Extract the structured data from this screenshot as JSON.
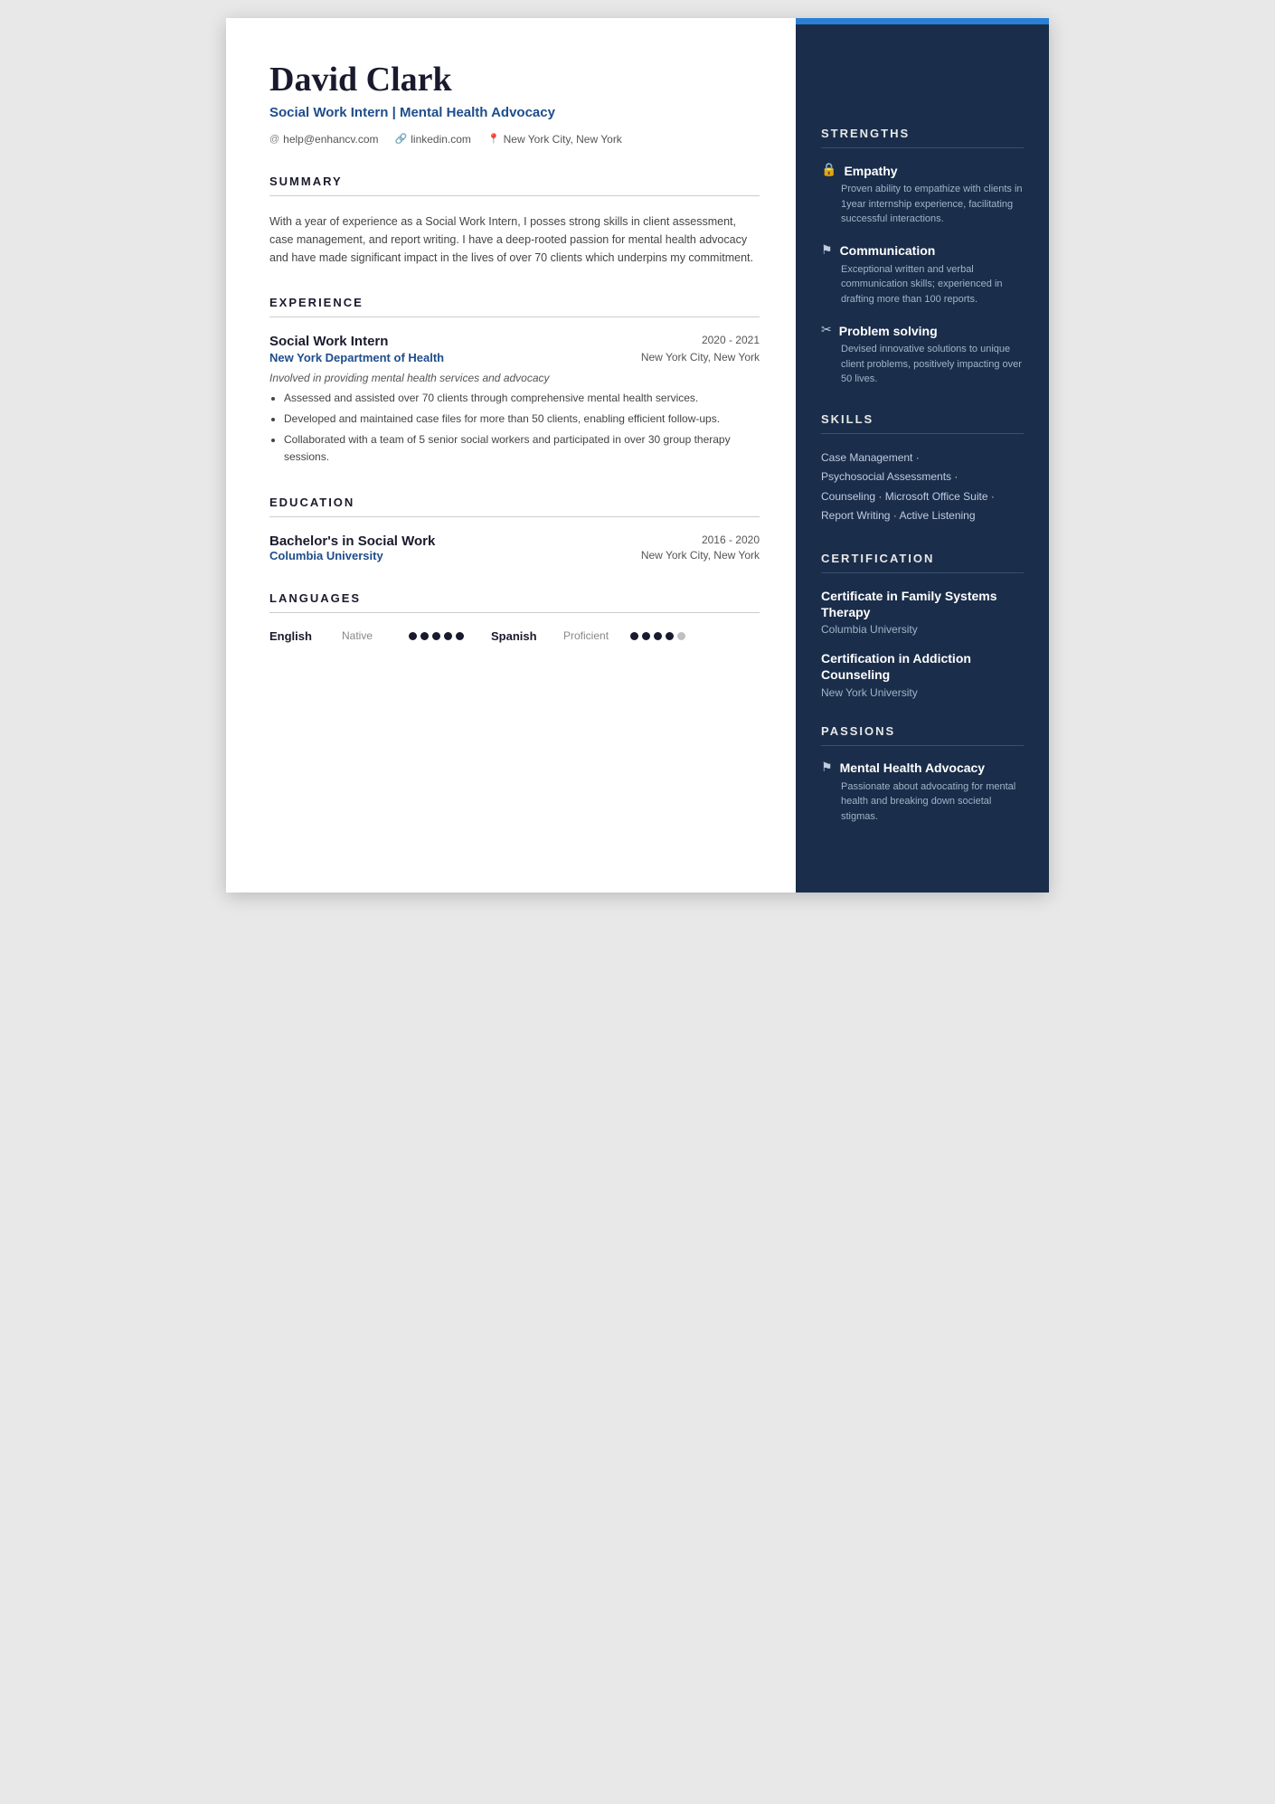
{
  "header": {
    "name": "David Clark",
    "title": "Social Work Intern | Mental Health Advocacy",
    "email": "help@enhancv.com",
    "linkedin": "linkedin.com",
    "location": "New York City, New York"
  },
  "summary": {
    "section_title": "SUMMARY",
    "text": "With a year of experience as a Social Work Intern, I posses strong skills in client assessment, case management, and report writing. I have a deep-rooted passion for mental health advocacy and have made significant impact in the lives of over 70 clients which underpins my commitment."
  },
  "experience": {
    "section_title": "EXPERIENCE",
    "jobs": [
      {
        "title": "Social Work Intern",
        "dates": "2020 - 2021",
        "company": "New York Department of Health",
        "location": "New York City, New York",
        "description": "Involved in providing mental health services and advocacy",
        "bullets": [
          "Assessed and assisted over 70 clients through comprehensive mental health services.",
          "Developed and maintained case files for more than 50 clients, enabling efficient follow-ups.",
          "Collaborated with a team of 5 senior social workers and participated in over 30 group therapy sessions."
        ]
      }
    ]
  },
  "education": {
    "section_title": "EDUCATION",
    "items": [
      {
        "degree": "Bachelor's in Social Work",
        "dates": "2016 - 2020",
        "school": "Columbia University",
        "location": "New York City, New York"
      }
    ]
  },
  "languages": {
    "section_title": "LANGUAGES",
    "items": [
      {
        "name": "English",
        "level": "Native",
        "dots_filled": 5,
        "dots_total": 5
      },
      {
        "name": "Spanish",
        "level": "Proficient",
        "dots_filled": 4,
        "dots_total": 5
      }
    ]
  },
  "strengths": {
    "section_title": "STRENGTHS",
    "items": [
      {
        "icon": "🔒",
        "title": "Empathy",
        "description": "Proven ability to empathize with clients in 1year internship experience, facilitating successful interactions."
      },
      {
        "icon": "⚑",
        "title": "Communication",
        "description": "Exceptional written and verbal communication skills; experienced in drafting more than 100 reports."
      },
      {
        "icon": "✂",
        "title": "Problem solving",
        "description": "Devised innovative solutions to unique client problems, positively impacting over 50 lives."
      }
    ]
  },
  "skills": {
    "section_title": "SKILLS",
    "lines": [
      "Case Management ·",
      "Psychosocial Assessments ·",
      "Counseling · Microsoft Office Suite ·",
      "Report Writing · Active Listening"
    ]
  },
  "certification": {
    "section_title": "CERTIFICATION",
    "items": [
      {
        "name": "Certificate in Family Systems Therapy",
        "school": "Columbia University"
      },
      {
        "name": "Certification in Addiction Counseling",
        "school": "New York University"
      }
    ]
  },
  "passions": {
    "section_title": "PASSIONS",
    "items": [
      {
        "icon": "⚑",
        "title": "Mental Health Advocacy",
        "description": "Passionate about advocating for mental health and breaking down societal stigmas."
      }
    ]
  }
}
